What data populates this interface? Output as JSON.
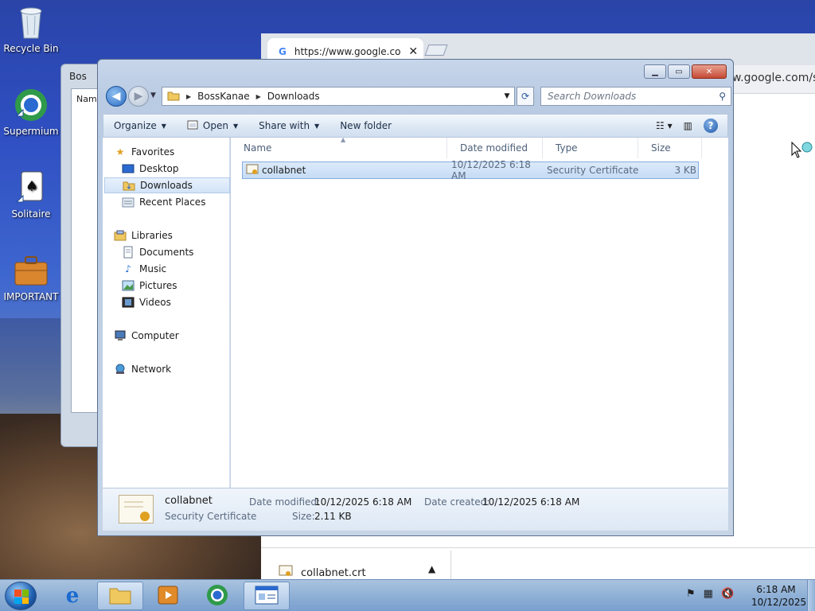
{
  "desktop": {
    "icons": [
      {
        "label": "Recycle Bin",
        "icon": "recycle-bin-icon"
      },
      {
        "label": "Supermium",
        "icon": "supermium-icon"
      },
      {
        "label": "Solitaire",
        "icon": "solitaire-icon"
      },
      {
        "label": "IMPORTANT",
        "icon": "briefcase-icon"
      }
    ]
  },
  "browser": {
    "tab_title": "https://www.google.co",
    "tab_close": "✕",
    "address_visible": "w.google.com/se",
    "download_item": "collabnet.crt"
  },
  "bg_window": {
    "title": "Bos",
    "column": "Name"
  },
  "explorer": {
    "breadcrumb": [
      "BossKanae",
      "Downloads"
    ],
    "search_placeholder": "Search Downloads",
    "toolbar": {
      "organize": "Organize",
      "open": "Open",
      "share_with": "Share with",
      "new_folder": "New folder"
    },
    "nav": {
      "favorites": "Favorites",
      "desktop": "Desktop",
      "downloads": "Downloads",
      "recent_places": "Recent Places",
      "libraries": "Libraries",
      "documents": "Documents",
      "music": "Music",
      "pictures": "Pictures",
      "videos": "Videos",
      "computer": "Computer",
      "network": "Network"
    },
    "columns": {
      "name": "Name",
      "date_modified": "Date modified",
      "type": "Type",
      "size": "Size"
    },
    "files": [
      {
        "name": "collabnet",
        "date_modified": "10/12/2025 6:18 AM",
        "type": "Security Certificate",
        "size": "3 KB"
      }
    ],
    "details": {
      "name": "collabnet",
      "type": "Security Certificate",
      "date_modified_label": "Date modified:",
      "date_modified": "10/12/2025 6:18 AM",
      "date_created_label": "Date created:",
      "date_created": "10/12/2025 6:18 AM",
      "size_label": "Size:",
      "size": "2.11 KB"
    }
  },
  "taskbar": {
    "time": "6:18 AM",
    "date": "10/12/2025"
  },
  "colors": {
    "selection_bg": "#c5dcf5",
    "selection_border": "#84acdd",
    "window_frame": "#b9cbe3",
    "close_red": "#c44a34"
  }
}
